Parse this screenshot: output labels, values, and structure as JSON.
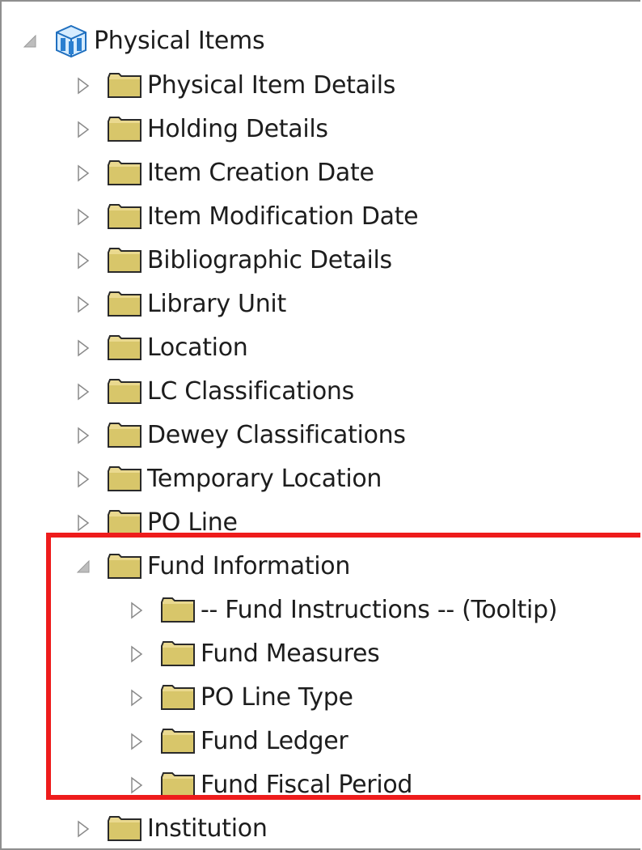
{
  "tree": {
    "root": {
      "label": "Physical Items",
      "icon": "subject-area-cube-icon",
      "expanded": true
    },
    "items": [
      {
        "label": "Physical Item Details",
        "expanded": false
      },
      {
        "label": "Holding Details",
        "expanded": false
      },
      {
        "label": "Item Creation Date",
        "expanded": false
      },
      {
        "label": "Item Modification Date",
        "expanded": false
      },
      {
        "label": "Bibliographic Details",
        "expanded": false
      },
      {
        "label": "Library Unit",
        "expanded": false
      },
      {
        "label": "Location",
        "expanded": false
      },
      {
        "label": "LC Classifications",
        "expanded": false
      },
      {
        "label": "Dewey Classifications",
        "expanded": false
      },
      {
        "label": "Temporary Location",
        "expanded": false
      },
      {
        "label": "PO Line",
        "expanded": false
      },
      {
        "label": "Fund Information",
        "expanded": true,
        "children": [
          {
            "label": "-- Fund Instructions -- (Tooltip)",
            "expanded": false
          },
          {
            "label": "Fund Measures",
            "expanded": false
          },
          {
            "label": "PO Line Type",
            "expanded": false
          },
          {
            "label": "Fund Ledger",
            "expanded": false
          },
          {
            "label": "Fund Fiscal Period",
            "expanded": false
          }
        ]
      },
      {
        "label": "Institution",
        "expanded": false
      }
    ]
  },
  "colors": {
    "highlight": "#ee1c1c",
    "folder": "#dccf84",
    "folder_border": "#2a2a2a",
    "cube": "#2a7fd0"
  }
}
